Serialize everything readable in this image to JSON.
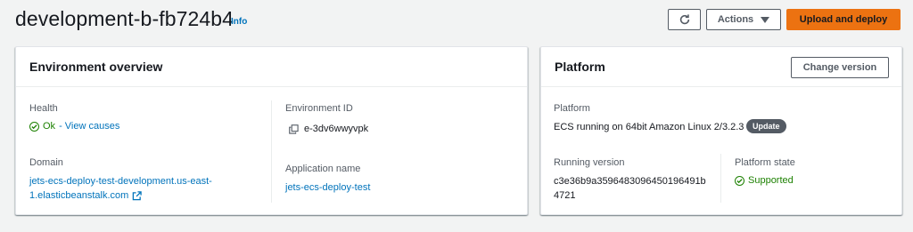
{
  "header": {
    "title": "development-b-fb724b4",
    "info": "Info",
    "actions_label": "Actions",
    "upload_label": "Upload and deploy"
  },
  "overview": {
    "title": "Environment overview",
    "health_label": "Health",
    "health_status": "Ok",
    "health_link": " - View causes",
    "domain_label": "Domain",
    "domain_line1": "jets-ecs-deploy-test-development.us-east-",
    "domain_line2": "1.elasticbeanstalk.com",
    "env_id_label": "Environment ID",
    "env_id": "e-3dv6wwyvpk",
    "app_name_label": "Application name",
    "app_name": "jets-ecs-deploy-test"
  },
  "platform": {
    "title": "Platform",
    "change_label": "Change version",
    "platform_label": "Platform",
    "platform_value": "ECS running on 64bit Amazon Linux 2/3.2.3",
    "update_badge": "Update",
    "running_label": "Running version",
    "running_line1": "c3e36b9a3596483096450196491b",
    "running_line2": "4721",
    "state_label": "Platform state",
    "state_value": "Supported"
  },
  "colors": {
    "primary": "#ec7211",
    "link": "#0073bb",
    "success": "#1d8102",
    "badge": "#545b64"
  },
  "icons": [
    "refresh-icon",
    "caret-down-icon",
    "check-circle-icon",
    "copy-icon",
    "external-link-icon"
  ]
}
